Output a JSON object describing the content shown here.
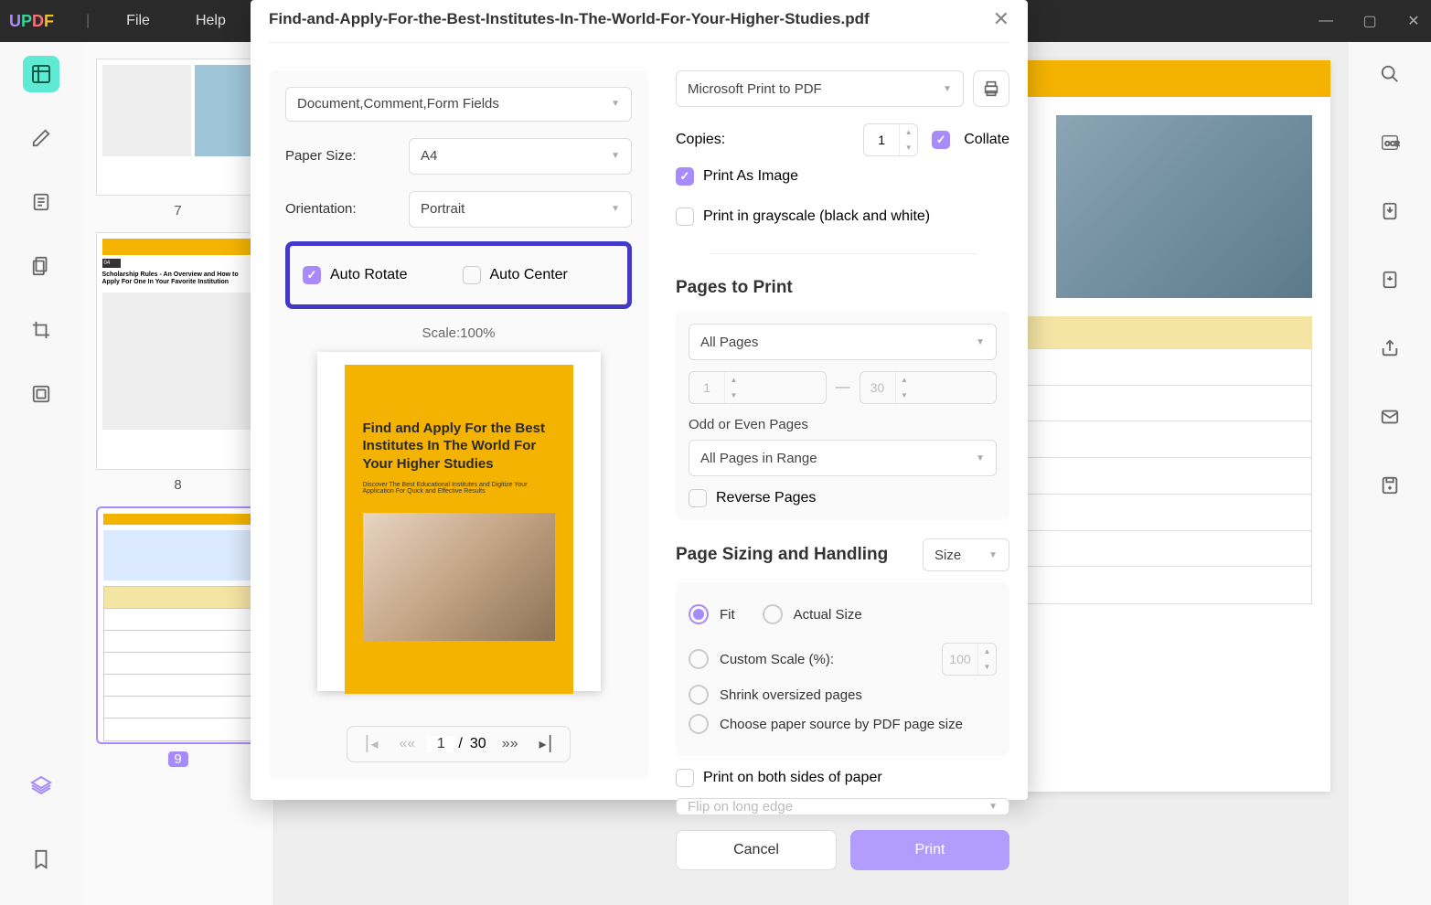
{
  "menubar": {
    "logo": "UPDF",
    "items": [
      "File",
      "Help"
    ]
  },
  "thumbs": {
    "p7": "7",
    "p8": "8",
    "p9": "9"
  },
  "dialog": {
    "title": "Find-and-Apply-For-the-Best-Institutes-In-The-World-For-Your-Higher-Studies.pdf",
    "left": {
      "doctype_select": "Document,Comment,Form Fields",
      "paper_size_label": "Paper Size:",
      "paper_size": "A4",
      "orientation_label": "Orientation:",
      "orientation": "Portrait",
      "auto_rotate": "Auto Rotate",
      "auto_center": "Auto Center",
      "scale_label": "Scale:100%",
      "preview_title": "Find and Apply For the Best Institutes In The World For Your Higher Studies",
      "preview_sub": "Discover The Best Educational Institutes and Digitize Your Application For Quick and Effective Results",
      "pager_current": "1",
      "pager_total": "30"
    },
    "right": {
      "printer": "Microsoft Print to PDF",
      "copies_label": "Copies:",
      "copies": "1",
      "collate": "Collate",
      "print_as_image": "Print As Image",
      "print_grayscale": "Print in grayscale (black and white)",
      "pages_to_print_title": "Pages to Print",
      "page_range": "All Pages",
      "range_from": "1",
      "range_to": "30",
      "odd_even_label": "Odd or Even Pages",
      "odd_even": "All Pages in Range",
      "reverse_pages": "Reverse Pages",
      "sizing_title": "Page Sizing and Handling",
      "size_tab": "Size",
      "fit": "Fit",
      "actual_size": "Actual Size",
      "custom_scale": "Custom Scale (%):",
      "custom_scale_value": "100",
      "shrink": "Shrink oversized pages",
      "paper_source": "Choose paper source by PDF page size",
      "duplex": "Print on both sides of paper",
      "flip": "Flip on long edge",
      "cancel": "Cancel",
      "print": "Print"
    }
  }
}
